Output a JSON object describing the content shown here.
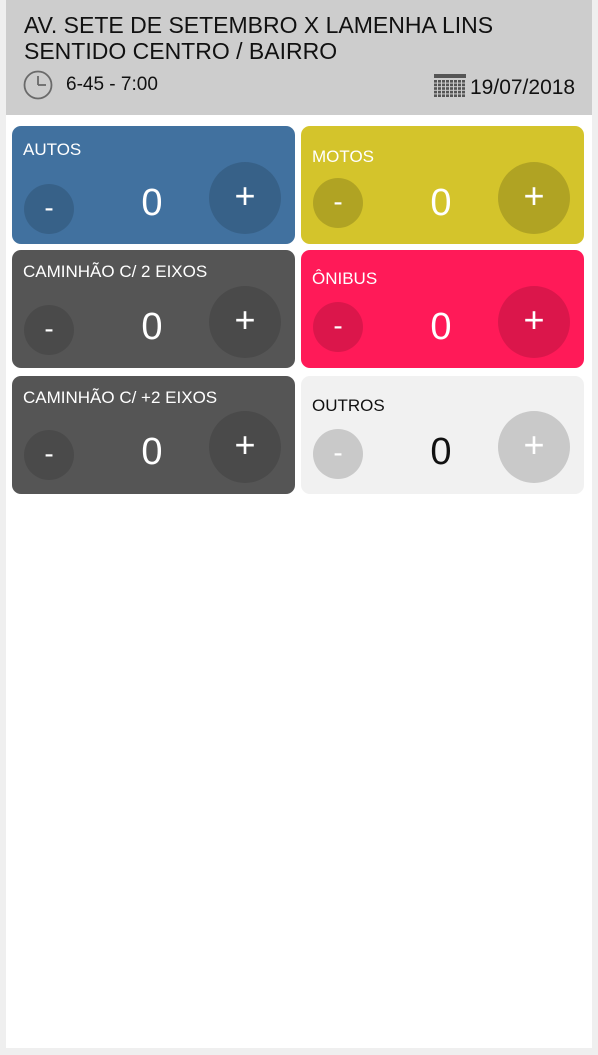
{
  "header": {
    "line1": "AV. SETE DE SETEMBRO X LAMENHA LINS",
    "line2": "SENTIDO CENTRO / BAIRRO",
    "time_range": "6-45 - 7:00",
    "date": "19/07/2018",
    "icons": [
      "clock-icon",
      "calendar-icon"
    ]
  },
  "counters": [
    {
      "label": "AUTOS",
      "count": "0",
      "minus": "-",
      "plus": "+",
      "color": "#41719f"
    },
    {
      "label": "MOTOS",
      "count": "0",
      "minus": "-",
      "plus": "+",
      "color": "#d4c42b"
    },
    {
      "label": "CAMINHÃO C/ 2 EIXOS",
      "count": "0",
      "minus": "-",
      "plus": "+",
      "color": "#555555"
    },
    {
      "label": "ÔNIBUS",
      "count": "0",
      "minus": "-",
      "plus": "+",
      "color": "#ff1a58"
    },
    {
      "label": "CAMINHÃO C/ +2 EIXOS",
      "count": "0",
      "minus": "-",
      "plus": "+",
      "color": "#555555"
    },
    {
      "label": "OUTROS",
      "count": "0",
      "minus": "-",
      "plus": "+",
      "color": "#f1f1f1"
    }
  ]
}
